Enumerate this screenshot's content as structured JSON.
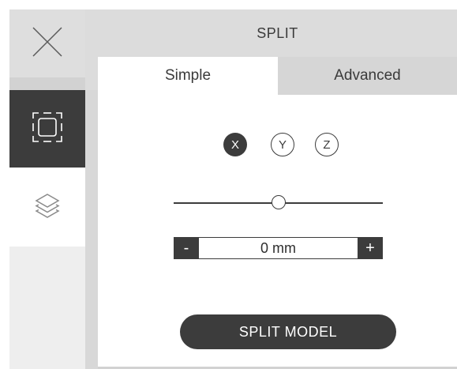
{
  "header": {
    "title": "SPLIT"
  },
  "tabs": [
    {
      "label": "Simple",
      "active": true
    },
    {
      "label": "Advanced",
      "active": false
    }
  ],
  "axes": [
    {
      "label": "X",
      "selected": true
    },
    {
      "label": "Y",
      "selected": false
    },
    {
      "label": "Z",
      "selected": false
    }
  ],
  "slider": {
    "value_fraction": 0.5
  },
  "stepper": {
    "minus_label": "-",
    "value": "0 mm",
    "plus_label": "+"
  },
  "actions": {
    "split_label": "SPLIT MODEL"
  },
  "rail": {
    "icons": [
      "close-icon",
      "select-bounds-icon",
      "layers-icon"
    ],
    "selected_color": "#3c3c3c"
  },
  "colors": {
    "accent": "#3c3c3c",
    "background": "#dcdcdc",
    "panel": "#ffffff"
  }
}
